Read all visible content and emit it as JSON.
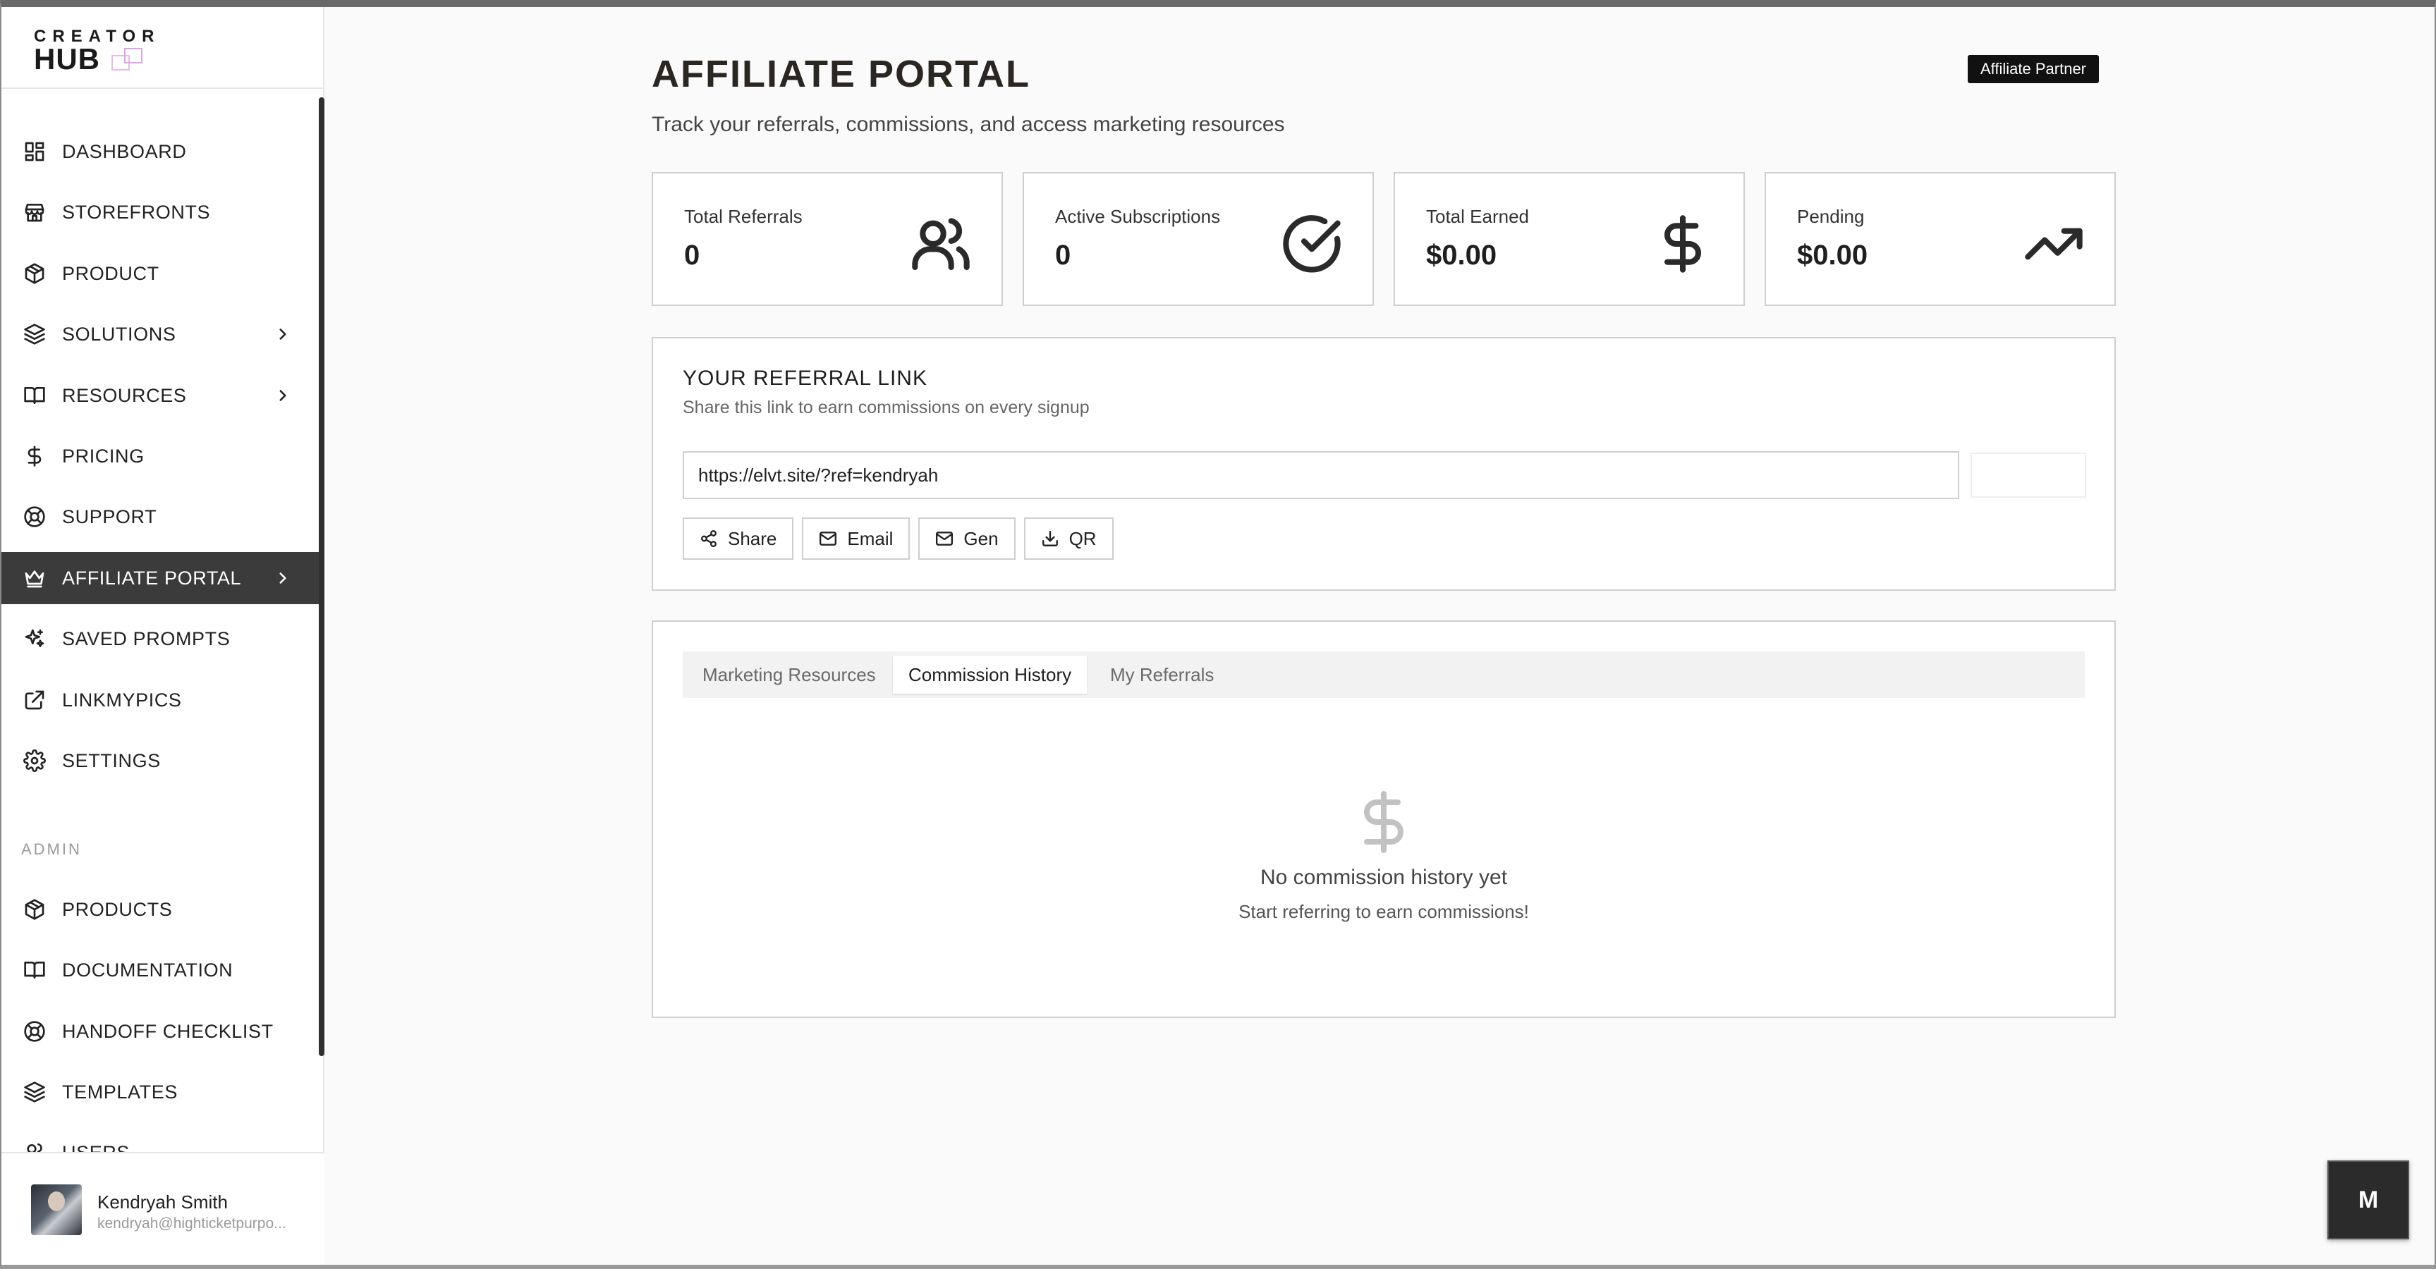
{
  "brand": {
    "line1": "CREATOR",
    "line2": "HUB"
  },
  "sidebar": {
    "items": [
      {
        "label": "DASHBOARD",
        "icon": "dashboard-icon"
      },
      {
        "label": "STOREFRONTS",
        "icon": "storefront-icon"
      },
      {
        "label": "PRODUCT",
        "icon": "box-icon"
      },
      {
        "label": "SOLUTIONS",
        "icon": "layers-icon",
        "has_chevron": true
      },
      {
        "label": "RESOURCES",
        "icon": "book-icon",
        "has_chevron": true
      },
      {
        "label": "PRICING",
        "icon": "dollar-icon"
      },
      {
        "label": "SUPPORT",
        "icon": "lifebuoy-icon"
      },
      {
        "label": "AFFILIATE PORTAL",
        "icon": "crown-icon",
        "has_chevron": true,
        "active": true
      },
      {
        "label": "SAVED PROMPTS",
        "icon": "sparkles-icon"
      },
      {
        "label": "LINKMYPICS",
        "icon": "external-link-icon"
      },
      {
        "label": "SETTINGS",
        "icon": "gear-icon"
      }
    ],
    "admin_label": "ADMIN",
    "admin_items": [
      {
        "label": "PRODUCTS",
        "icon": "box-icon"
      },
      {
        "label": "DOCUMENTATION",
        "icon": "book-icon"
      },
      {
        "label": "HANDOFF CHECKLIST",
        "icon": "lifebuoy-icon"
      },
      {
        "label": "TEMPLATES",
        "icon": "layers-icon"
      },
      {
        "label": "USERS",
        "icon": "users-icon"
      }
    ],
    "user": {
      "name": "Kendryah Smith",
      "email": "kendryah@highticketpurpo..."
    }
  },
  "header": {
    "title": "AFFILIATE PORTAL",
    "subtitle": "Track your referrals, commissions, and access marketing resources",
    "badge": "Affiliate Partner"
  },
  "stats": [
    {
      "label": "Total Referrals",
      "value": "0",
      "icon": "users-icon"
    },
    {
      "label": "Active Subscriptions",
      "value": "0",
      "icon": "check-circle-icon"
    },
    {
      "label": "Total Earned",
      "value": "$0.00",
      "icon": "dollar-icon"
    },
    {
      "label": "Pending",
      "value": "$0.00",
      "icon": "trending-up-icon"
    }
  ],
  "referral": {
    "title": "YOUR REFERRAL LINK",
    "description": "Share this link to earn commissions on every signup",
    "link": "https://elvt.site/?ref=kendryah",
    "buttons": {
      "share": "Share",
      "email": "Email",
      "gen": "Gen",
      "qr": "QR"
    }
  },
  "tabs": {
    "items": [
      "Marketing Resources",
      "Commission History",
      "My Referrals"
    ],
    "active": "Commission History"
  },
  "empty_state": {
    "title": "No commission history yet",
    "subtitle": "Start referring to earn commissions!"
  },
  "floating_button": {
    "label": "M"
  },
  "colors": {
    "active_nav_bg": "#3b3b3b",
    "badge_bg": "#111111",
    "border": "#cfcfcf"
  }
}
